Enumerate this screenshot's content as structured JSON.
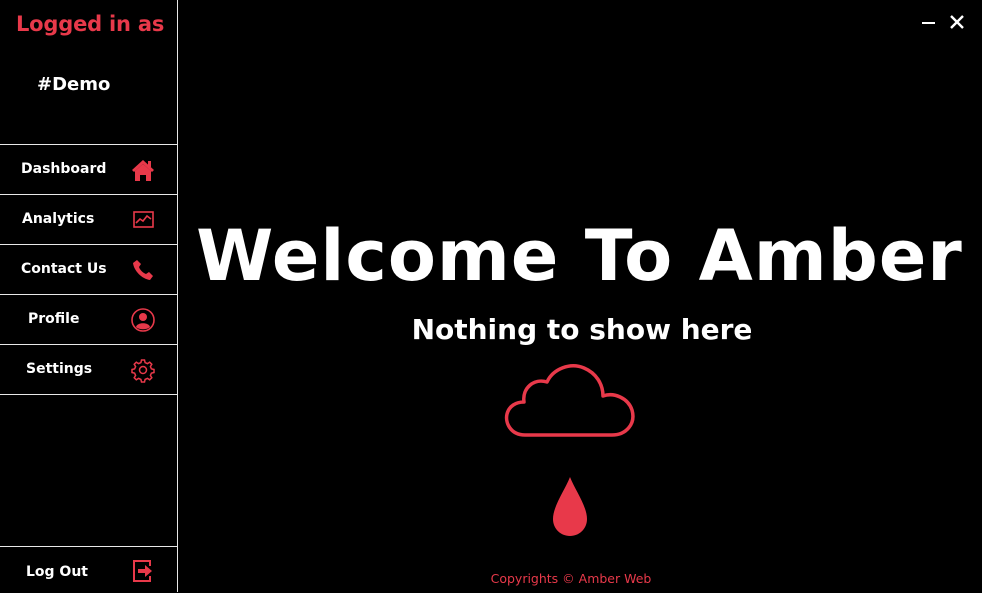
{
  "sidebar": {
    "logged_label": "Logged in as",
    "username": "#Demo",
    "items": [
      {
        "label": "Dashboard",
        "icon": "home-icon"
      },
      {
        "label": "Analytics",
        "icon": "analytics-icon"
      },
      {
        "label": "Contact Us",
        "icon": "phone-icon"
      },
      {
        "label": "Profile",
        "icon": "profile-icon"
      },
      {
        "label": "Settings",
        "icon": "gear-icon"
      }
    ],
    "logout": {
      "label": "Log Out",
      "icon": "logout-icon"
    }
  },
  "window": {
    "minimize_icon": "minimize-icon",
    "close_icon": "close-icon"
  },
  "main": {
    "title": "Welcome To Amber",
    "subtitle": "Nothing to show here",
    "illustration_icons": [
      "cloud-icon",
      "raindrop-icon"
    ],
    "copyright": "Copyrights © Amber Web"
  },
  "colors": {
    "accent": "#e8394a",
    "background": "#000000",
    "text": "#ffffff",
    "divider": "#e8e8e8"
  }
}
